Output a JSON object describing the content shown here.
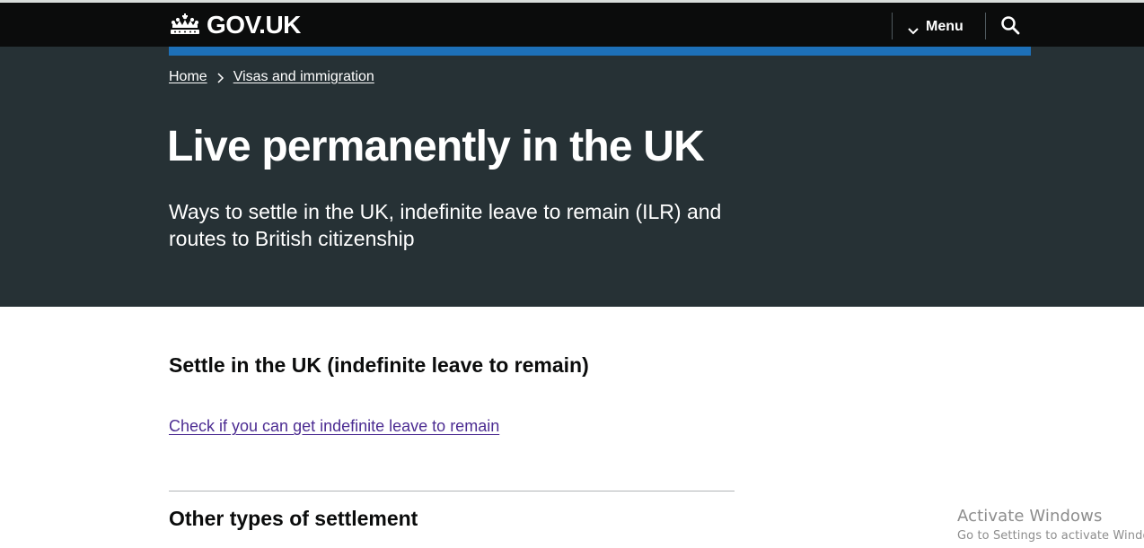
{
  "header": {
    "logo_text": "GOV.UK",
    "menu_label": "Menu",
    "brand_background": "#0b0c0c",
    "accent_bar_color": "#1d70b8"
  },
  "breadcrumbs": [
    {
      "label": "Home"
    },
    {
      "label": "Visas and immigration"
    }
  ],
  "hero": {
    "title": "Live permanently in the UK",
    "subtitle": "Ways to settle in the UK, indefinite leave to remain (ILR) and routes to British citizenship",
    "background": "#263135"
  },
  "main": {
    "section_heading": "Settle in the UK (indefinite leave to remain)",
    "section_link": "Check if you can get indefinite leave to remain",
    "second_heading": "Other types of settlement",
    "link_color": "#4c2c92"
  },
  "watermark": {
    "title": "Activate Windows",
    "subtitle": "Go to Settings to activate Windows."
  },
  "icons": {
    "logo": "crown-icon",
    "menu": "chevron-down-icon",
    "search": "search-icon",
    "breadcrumb_separator": "chevron-right-icon"
  }
}
